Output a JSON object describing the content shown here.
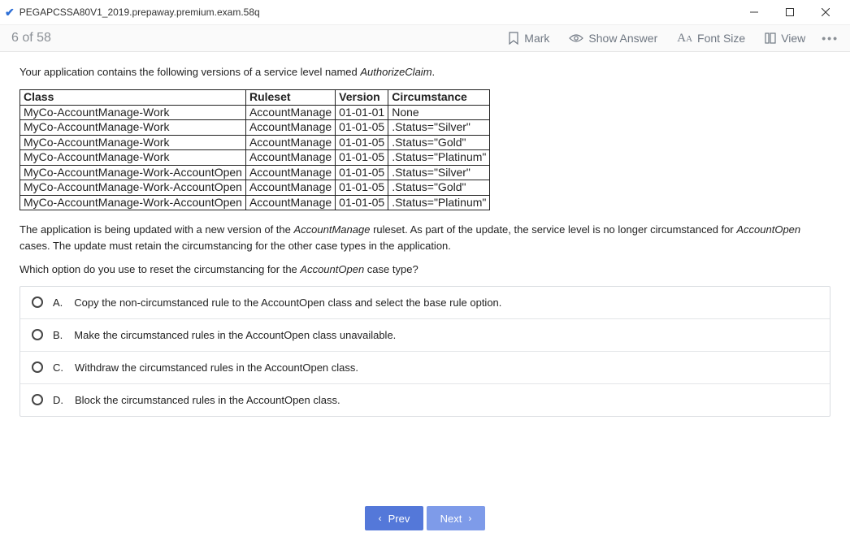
{
  "window": {
    "title": "PEGAPCSSA80V1_2019.prepaway.premium.exam.58q"
  },
  "toolbar": {
    "counter": "6 of 58",
    "mark": "Mark",
    "show_answer": "Show Answer",
    "font_size": "Font Size",
    "view": "View"
  },
  "question": {
    "intro_pre": "Your application contains the following versions of a service level named ",
    "intro_em": "AuthorizeClaim",
    "intro_post": ".",
    "headers": {
      "class": "Class",
      "ruleset": "Ruleset",
      "version": "Version",
      "circumstance": "Circumstance"
    },
    "rows": [
      {
        "class": "MyCo-AccountManage-Work",
        "ruleset": "AccountManage",
        "version": "01-01-01",
        "circumstance": "None"
      },
      {
        "class": "MyCo-AccountManage-Work",
        "ruleset": "AccountManage",
        "version": "01-01-05",
        "circumstance": ".Status=\"Silver\""
      },
      {
        "class": "MyCo-AccountManage-Work",
        "ruleset": "AccountManage",
        "version": "01-01-05",
        "circumstance": ".Status=\"Gold\""
      },
      {
        "class": "MyCo-AccountManage-Work",
        "ruleset": "AccountManage",
        "version": "01-01-05",
        "circumstance": ".Status=\"Platinum\""
      },
      {
        "class": "MyCo-AccountManage-Work-AccountOpen",
        "ruleset": "AccountManage",
        "version": "01-01-05",
        "circumstance": ".Status=\"Silver\""
      },
      {
        "class": "MyCo-AccountManage-Work-AccountOpen",
        "ruleset": "AccountManage",
        "version": "01-01-05",
        "circumstance": ".Status=\"Gold\""
      },
      {
        "class": "MyCo-AccountManage-Work-AccountOpen",
        "ruleset": "AccountManage",
        "version": "01-01-05",
        "circumstance": ".Status=\"Platinum\""
      }
    ],
    "para1_a": "The application is being updated with a new version of the ",
    "para1_em1": "AccountManage",
    "para1_b": " ruleset. As part of the update, the service level is no longer circumstanced for ",
    "para1_em2": "AccountOpen",
    "para1_c": " cases. The update must retain the circumstancing for the other case types in the application.",
    "para2_a": "Which option do you use to reset the circumstancing for the ",
    "para2_em": "AccountOpen",
    "para2_b": " case type?"
  },
  "answers": [
    {
      "letter": "A.",
      "text": "Copy the non-circumstanced rule to the AccountOpen class and select the base rule option."
    },
    {
      "letter": "B.",
      "text": "Make the circumstanced rules in the AccountOpen class unavailable."
    },
    {
      "letter": "C.",
      "text": "Withdraw the circumstanced rules in the AccountOpen class."
    },
    {
      "letter": "D.",
      "text": "Block the circumstanced rules in the AccountOpen class."
    }
  ],
  "nav": {
    "prev": "Prev",
    "next": "Next"
  }
}
